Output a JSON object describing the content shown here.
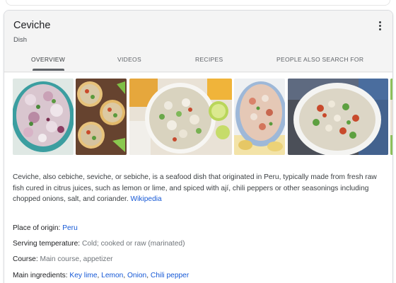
{
  "entity": {
    "title": "Ceviche",
    "subtitle": "Dish"
  },
  "tabs": [
    {
      "label": "OVERVIEW",
      "selected": true
    },
    {
      "label": "VIDEOS"
    },
    {
      "label": "RECIPES"
    },
    {
      "label": "PEOPLE ALSO SEARCH FOR"
    }
  ],
  "description": {
    "text": "Ceviche, also cebiche, seviche, or sebiche, is a seafood dish that originated in Peru, typically made from fresh raw fish cured in citrus juices, such as lemon or lime, and spiced with ají, chili peppers or other seasonings including chopped onions, salt, and coriander.",
    "source_link": "Wikipedia"
  },
  "facts": [
    {
      "label": "Place of origin: ",
      "links": [
        "Peru"
      ]
    },
    {
      "label": "Serving temperature: ",
      "value": "Cold; cooked or raw (marinated)"
    },
    {
      "label": "Course: ",
      "value": "Main course, appetizer"
    },
    {
      "label": "Main ingredients: ",
      "links": [
        "Key lime",
        "Lemon",
        "Onion",
        "Chili pepper"
      ]
    }
  ],
  "colors": {
    "link": "#1558d6",
    "header_bg": "#f4f4f4",
    "muted_text": "#70757a"
  },
  "icons": {
    "more": "more-vert-icon"
  }
}
